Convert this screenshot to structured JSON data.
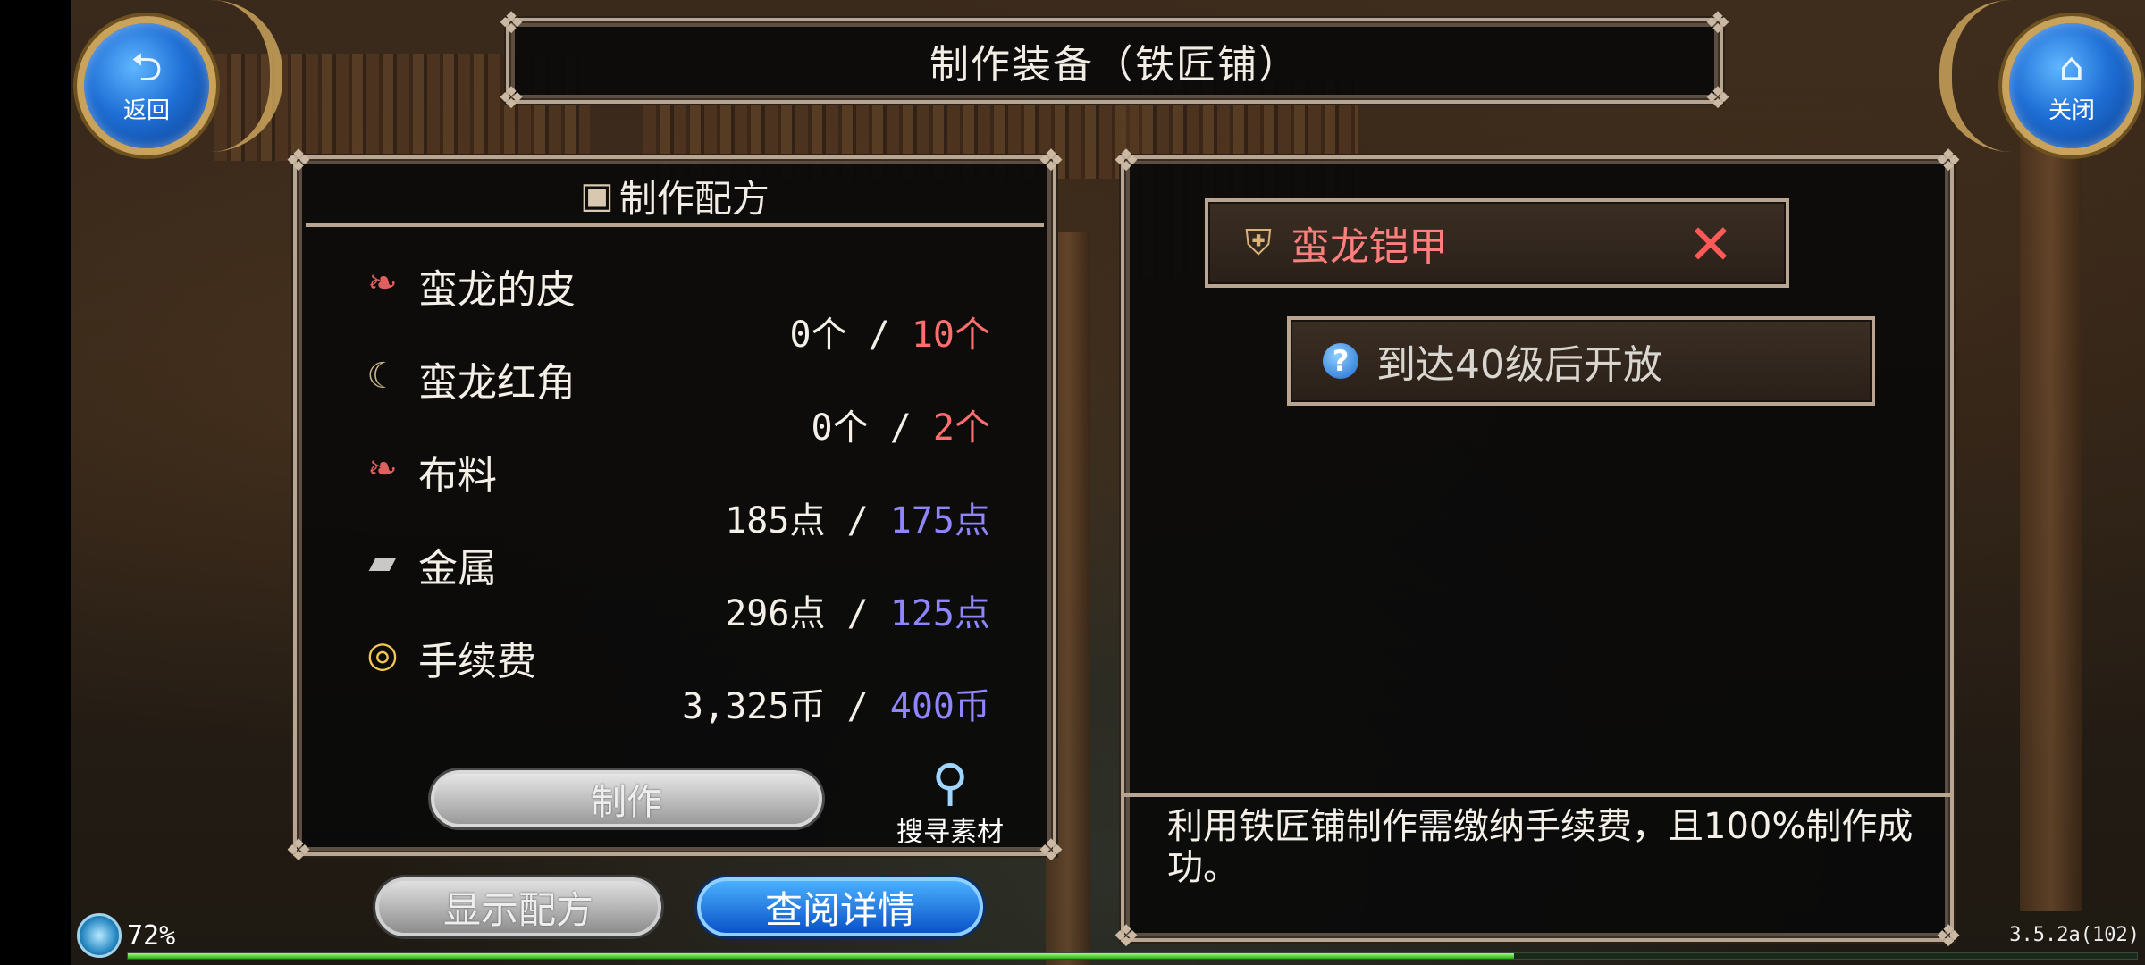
{
  "window": {
    "title": "制作装备（铁匠铺）"
  },
  "nav": {
    "back_label": "返回",
    "back_icon": "return-arrow-icon",
    "close_label": "关闭",
    "close_icon": "home-icon"
  },
  "recipe": {
    "title": "制作配方",
    "title_icon": "chest-icon",
    "materials": [
      {
        "name": "蛮龙的皮",
        "icon": "hide-icon",
        "have": "0个",
        "need": "10个",
        "need_color": "#ff6e6e"
      },
      {
        "name": "蛮龙红角",
        "icon": "horn-icon",
        "have": "0个",
        "need": "2个",
        "need_color": "#ff6e6e"
      },
      {
        "name": "布料",
        "icon": "cloth-icon",
        "have": "185点",
        "need": "175点",
        "need_color": "#8f86ff"
      },
      {
        "name": "金属",
        "icon": "metal-ingot-icon",
        "have": "296点",
        "need": "125点",
        "need_color": "#8f86ff"
      },
      {
        "name": "手续费",
        "icon": "coin-icon",
        "have": "3,325币",
        "need": "400币",
        "need_color": "#8f86ff"
      }
    ],
    "separator": "/",
    "craft_label": "制作",
    "search_label": "搜寻素材",
    "search_icon": "magnifier-icon"
  },
  "buttons": {
    "show_recipe": "显示配方",
    "view_detail": "查阅详情"
  },
  "item": {
    "name": "蛮龙铠甲",
    "icon": "armor-icon",
    "unlock_text": "到达40级后开放",
    "unlock_icon": "question-icon",
    "info": "利用铁匠铺制作需缴纳手续费，且100%制作成功。"
  },
  "status": {
    "battery_label": "72%",
    "battery_level": 0.72,
    "version": "3.5.2a(102)",
    "exp_progress": 0.69
  },
  "colors": {
    "need_insufficient": "#ff6e6e",
    "need_sufficient": "#8f86ff",
    "accent_blue": "#1f6fd6",
    "frame": "#b8a692"
  }
}
